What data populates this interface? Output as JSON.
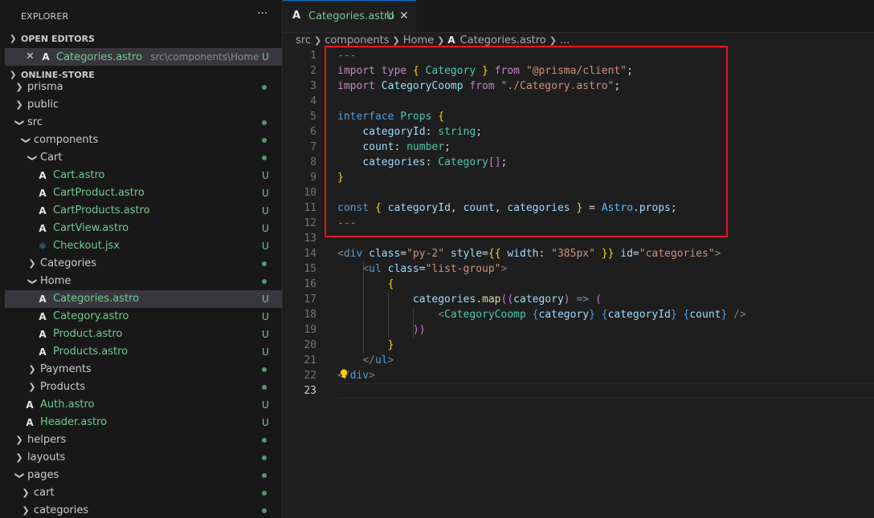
{
  "explorer": {
    "title": "EXPLORER",
    "more_label": "···",
    "open_editors_label": "OPEN EDITORS",
    "open_editor": {
      "name": "Categories.astro",
      "path": "src\\components\\Home",
      "badge": "U"
    },
    "project_label": "ONLINE-STORE",
    "tree": [
      {
        "label": "prisma",
        "kind": "folder",
        "expanded": false,
        "status": "dot"
      },
      {
        "label": "public",
        "kind": "folder",
        "expanded": false,
        "status": "none"
      },
      {
        "label": "src",
        "kind": "folder",
        "expanded": true,
        "status": "dot"
      },
      {
        "label": "components",
        "kind": "folder",
        "expanded": true,
        "status": "dot"
      },
      {
        "label": "Cart",
        "kind": "folder",
        "expanded": true,
        "status": "dot"
      },
      {
        "label": "Cart.astro",
        "kind": "astro",
        "status": "U"
      },
      {
        "label": "CartProduct.astro",
        "kind": "astro",
        "status": "U"
      },
      {
        "label": "CartProducts.astro",
        "kind": "astro",
        "status": "U"
      },
      {
        "label": "CartView.astro",
        "kind": "astro",
        "status": "U"
      },
      {
        "label": "Checkout.jsx",
        "kind": "react",
        "status": "U"
      },
      {
        "label": "Categories",
        "kind": "folder",
        "expanded": false,
        "status": "dot"
      },
      {
        "label": "Home",
        "kind": "folder",
        "expanded": true,
        "status": "dot"
      },
      {
        "label": "Categories.astro",
        "kind": "astro",
        "status": "U",
        "selected": true
      },
      {
        "label": "Category.astro",
        "kind": "astro",
        "status": "U"
      },
      {
        "label": "Product.astro",
        "kind": "astro",
        "status": "U"
      },
      {
        "label": "Products.astro",
        "kind": "astro",
        "status": "U"
      },
      {
        "label": "Payments",
        "kind": "folder",
        "expanded": false,
        "status": "dot"
      },
      {
        "label": "Products",
        "kind": "folder",
        "expanded": false,
        "status": "dot"
      },
      {
        "label": "Auth.astro",
        "kind": "astro",
        "status": "U"
      },
      {
        "label": "Header.astro",
        "kind": "astro",
        "status": "U"
      },
      {
        "label": "helpers",
        "kind": "folder",
        "expanded": false,
        "status": "dot"
      },
      {
        "label": "layouts",
        "kind": "folder",
        "expanded": false,
        "status": "dot"
      },
      {
        "label": "pages",
        "kind": "folder",
        "expanded": true,
        "status": "dot"
      },
      {
        "label": "cart",
        "kind": "folder",
        "expanded": false,
        "status": "dot"
      },
      {
        "label": "categories",
        "kind": "folder",
        "expanded": false,
        "status": "dot"
      }
    ]
  },
  "tab": {
    "label": "Categories.astro",
    "badge": "U",
    "close": "✕"
  },
  "breadcrumb": [
    "src",
    "components",
    "Home",
    "Categories.astro",
    "..."
  ],
  "editor": {
    "active_line": 23,
    "lines": [
      [
        [
          "---",
          "#6a9955"
        ]
      ],
      [
        [
          "import ",
          "#c586c0"
        ],
        [
          "type ",
          "#c586c0"
        ],
        [
          "{ ",
          "#ffd700"
        ],
        [
          "Category ",
          "#4ec9b0"
        ],
        [
          "} ",
          "#ffd700"
        ],
        [
          "from ",
          "#c586c0"
        ],
        [
          "\"@prisma/client\"",
          "#ce9178"
        ],
        [
          ";",
          "#d4d4d4"
        ]
      ],
      [
        [
          "import ",
          "#c586c0"
        ],
        [
          "CategoryCoomp ",
          "#9cdcfe"
        ],
        [
          "from ",
          "#c586c0"
        ],
        [
          "\"./Category.astro\"",
          "#ce9178"
        ],
        [
          ";",
          "#d4d4d4"
        ]
      ],
      [],
      [
        [
          "interface ",
          "#569cd6"
        ],
        [
          "Props ",
          "#4ec9b0"
        ],
        [
          "{",
          "#ffd700"
        ]
      ],
      [
        [
          "    ",
          "#d4d4d4"
        ],
        [
          "categoryId",
          "#9cdcfe"
        ],
        [
          ": ",
          "#d4d4d4"
        ],
        [
          "string",
          "#4ec9b0"
        ],
        [
          ";",
          "#d4d4d4"
        ]
      ],
      [
        [
          "    ",
          "#d4d4d4"
        ],
        [
          "count",
          "#9cdcfe"
        ],
        [
          ": ",
          "#d4d4d4"
        ],
        [
          "number",
          "#4ec9b0"
        ],
        [
          ";",
          "#d4d4d4"
        ]
      ],
      [
        [
          "    ",
          "#d4d4d4"
        ],
        [
          "categories",
          "#9cdcfe"
        ],
        [
          ": ",
          "#d4d4d4"
        ],
        [
          "Category",
          "#4ec9b0"
        ],
        [
          "[]",
          "#da70d6"
        ],
        [
          ";",
          "#d4d4d4"
        ]
      ],
      [
        [
          "}",
          "#ffd700"
        ]
      ],
      [],
      [
        [
          "const ",
          "#569cd6"
        ],
        [
          "{ ",
          "#ffd700"
        ],
        [
          "categoryId",
          "#9cdcfe"
        ],
        [
          ", ",
          "#d4d4d4"
        ],
        [
          "count",
          "#9cdcfe"
        ],
        [
          ", ",
          "#d4d4d4"
        ],
        [
          "categories ",
          "#9cdcfe"
        ],
        [
          "} ",
          "#ffd700"
        ],
        [
          "= ",
          "#d4d4d4"
        ],
        [
          "Astro",
          "#4fc1ff"
        ],
        [
          ".",
          "#d4d4d4"
        ],
        [
          "props",
          "#9cdcfe"
        ],
        [
          ";",
          "#d4d4d4"
        ]
      ],
      [
        [
          "---",
          "#6a9955"
        ]
      ],
      [],
      [
        [
          "<",
          "#808080"
        ],
        [
          "div ",
          "#569cd6"
        ],
        [
          "class",
          "#9cdcfe"
        ],
        [
          "=",
          "#d4d4d4"
        ],
        [
          "\"py-2\" ",
          "#ce9178"
        ],
        [
          "style",
          "#9cdcfe"
        ],
        [
          "=",
          "#d4d4d4"
        ],
        [
          "{{ ",
          "#ffd700"
        ],
        [
          "width",
          "#9cdcfe"
        ],
        [
          ": ",
          "#d4d4d4"
        ],
        [
          "\"385px\" ",
          "#ce9178"
        ],
        [
          "}} ",
          "#ffd700"
        ],
        [
          "id",
          "#9cdcfe"
        ],
        [
          "=",
          "#d4d4d4"
        ],
        [
          "\"categories\"",
          "#ce9178"
        ],
        [
          ">",
          "#808080"
        ]
      ],
      [
        [
          "    ",
          "#d4d4d4"
        ],
        [
          "<",
          "#808080"
        ],
        [
          "ul ",
          "#569cd6"
        ],
        [
          "class",
          "#9cdcfe"
        ],
        [
          "=",
          "#d4d4d4"
        ],
        [
          "\"list-group\"",
          "#ce9178"
        ],
        [
          ">",
          "#808080"
        ]
      ],
      [
        [
          "        ",
          "#d4d4d4"
        ],
        [
          "{",
          "#ffd700"
        ]
      ],
      [
        [
          "            ",
          "#d4d4d4"
        ],
        [
          "categories",
          "#9cdcfe"
        ],
        [
          ".",
          "#d4d4d4"
        ],
        [
          "map",
          "#dcdcaa"
        ],
        [
          "((",
          "#da70d6"
        ],
        [
          "category",
          "#9cdcfe"
        ],
        [
          ") ",
          "#da70d6"
        ],
        [
          "=> ",
          "#569cd6"
        ],
        [
          "(",
          "#da70d6"
        ]
      ],
      [
        [
          "                ",
          "#d4d4d4"
        ],
        [
          "<",
          "#808080"
        ],
        [
          "CategoryCoomp ",
          "#4ec9b0"
        ],
        [
          "{",
          "#569cd6"
        ],
        [
          "category",
          "#9cdcfe"
        ],
        [
          "} ",
          "#569cd6"
        ],
        [
          "{",
          "#569cd6"
        ],
        [
          "categoryId",
          "#9cdcfe"
        ],
        [
          "} ",
          "#569cd6"
        ],
        [
          "{",
          "#569cd6"
        ],
        [
          "count",
          "#9cdcfe"
        ],
        [
          "} ",
          "#569cd6"
        ],
        [
          "/>",
          "#808080"
        ]
      ],
      [
        [
          "            ",
          "#d4d4d4"
        ],
        [
          "))",
          "#da70d6"
        ]
      ],
      [
        [
          "        ",
          "#d4d4d4"
        ],
        [
          "}",
          "#ffd700"
        ]
      ],
      [
        [
          "    ",
          "#d4d4d4"
        ],
        [
          "</",
          "#808080"
        ],
        [
          "ul",
          "#569cd6"
        ],
        [
          ">",
          "#808080"
        ]
      ],
      [
        [
          "</",
          "#808080"
        ],
        [
          "div",
          "#569cd6"
        ],
        [
          ">",
          "#808080"
        ]
      ],
      []
    ]
  }
}
